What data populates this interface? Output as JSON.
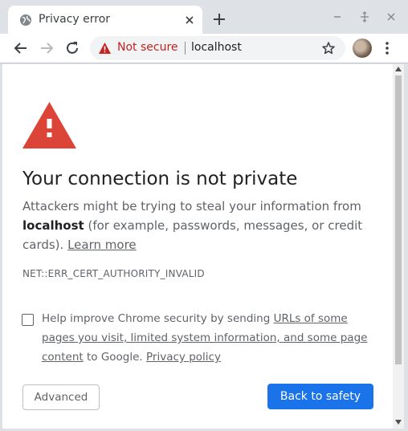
{
  "tab": {
    "title": "Privacy error",
    "favicon": "globe-icon"
  },
  "omnibox": {
    "security_label": "Not secure",
    "url": "localhost"
  },
  "interstitial": {
    "heading": "Your connection is not private",
    "explanation_prefix": "Attackers might be trying to steal your information from",
    "host": "localhost",
    "explanation_suffix": "(for example, passwords, messages, or credit cards).",
    "learn_more_label": "Learn more",
    "error_code": "NET::ERR_CERT_AUTHORITY_INVALID",
    "optin": {
      "prefix": "Help improve Chrome security by sending",
      "link_label": "URLs of some pages you visit, limited system information, and some page content",
      "middle": "to Google.",
      "privacy_label": "Privacy policy",
      "checked": false
    },
    "advanced_label": "Advanced",
    "back_label": "Back to safety"
  },
  "colors": {
    "warning_red": "#db4437",
    "not_secure_red": "#c5221f",
    "primary_blue": "#1a73e8",
    "text_secondary": "#5f6368"
  },
  "icons": [
    "globe-icon",
    "close-icon",
    "plus-icon",
    "minimize-icon",
    "maximize-icon",
    "window-close-icon",
    "back-arrow-icon",
    "forward-arrow-icon",
    "reload-icon",
    "warning-triangle-icon",
    "star-icon",
    "profile-avatar",
    "more-vert-icon"
  ]
}
